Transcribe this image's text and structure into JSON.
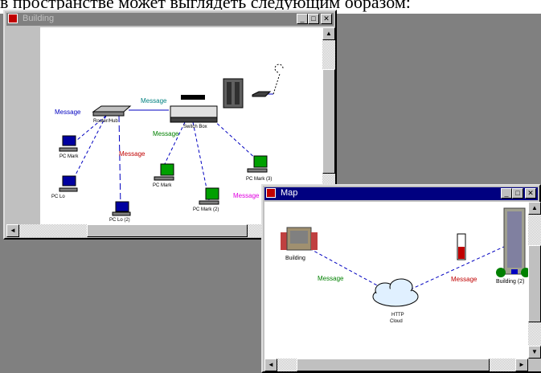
{
  "background_text": "в пространстве может выглядеть следующим образом:",
  "building_window": {
    "title": "Building",
    "buttons": {
      "minimize": "_",
      "maximize": "□",
      "close": "✕"
    },
    "scrollbar": {
      "up": "▲",
      "down": "▼",
      "left": "◄",
      "right": "►"
    },
    "labels": {
      "message_green": "Message",
      "message_blue": "Message",
      "message_red": "Message",
      "message_teal": "Message",
      "message_magenta": "Message",
      "hub": "Router/Hub",
      "switch": "Switch Box",
      "pc1": "PC Mark",
      "pc2": "PC Lo",
      "pc3": "PC Lo (2)",
      "pc4": "PC Mark",
      "pc5": "PC Mark (2)",
      "pc6": "PC Mark (3)"
    }
  },
  "map_window": {
    "title": "Map",
    "buttons": {
      "minimize": "_",
      "maximize": "□",
      "close": "✕"
    },
    "scrollbar": {
      "up": "▲",
      "down": "▼",
      "left": "◄",
      "right": "►"
    },
    "labels": {
      "building1": "Building",
      "building2": "Building (2)",
      "message_green": "Message",
      "message_red": "Message",
      "cloud_line1": "HTTP",
      "cloud_line2": "Cloud"
    }
  },
  "colors": {
    "green": "#008000",
    "blue": "#0000c0",
    "red": "#c00000",
    "teal": "#008080",
    "magenta": "#e000e0",
    "titlebar_active": "#000080",
    "titlebar_inactive": "#808080"
  }
}
